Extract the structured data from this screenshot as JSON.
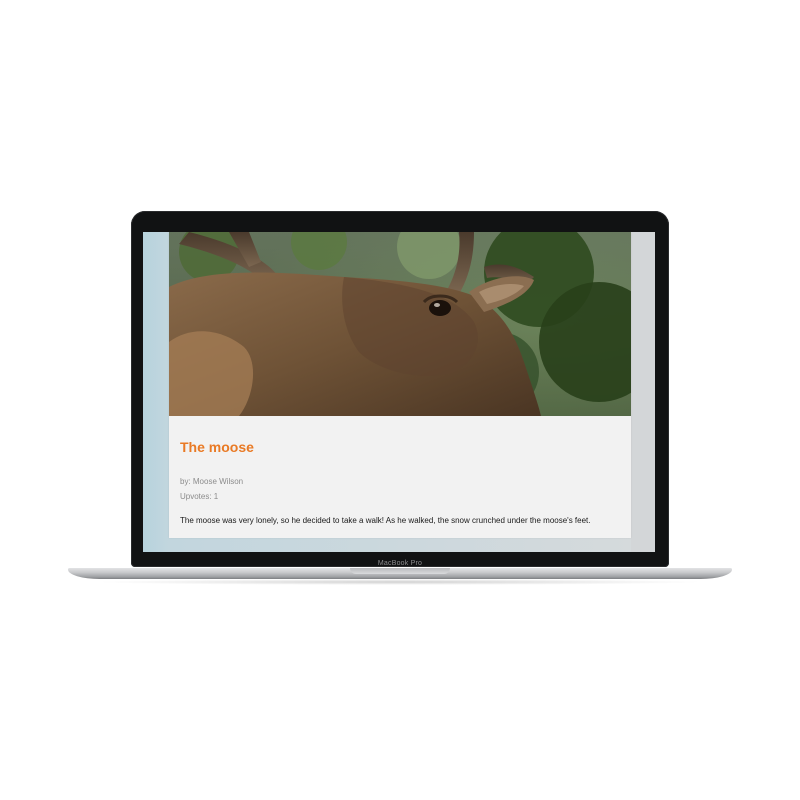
{
  "device": {
    "model_label": "MacBook Pro"
  },
  "post": {
    "title": "The moose",
    "author": "by: Moose Wilson",
    "upvotes": "Upvotes: 1",
    "body": "The moose was very lonely, so he decided to take a walk! As he walked, the snow crunched under the moose's feet.",
    "hero_image": "moose-photo"
  },
  "colors": {
    "title_accent": "#e97a25",
    "card_background": "#f2f2f2",
    "meta_text": "#8c8c8c"
  }
}
